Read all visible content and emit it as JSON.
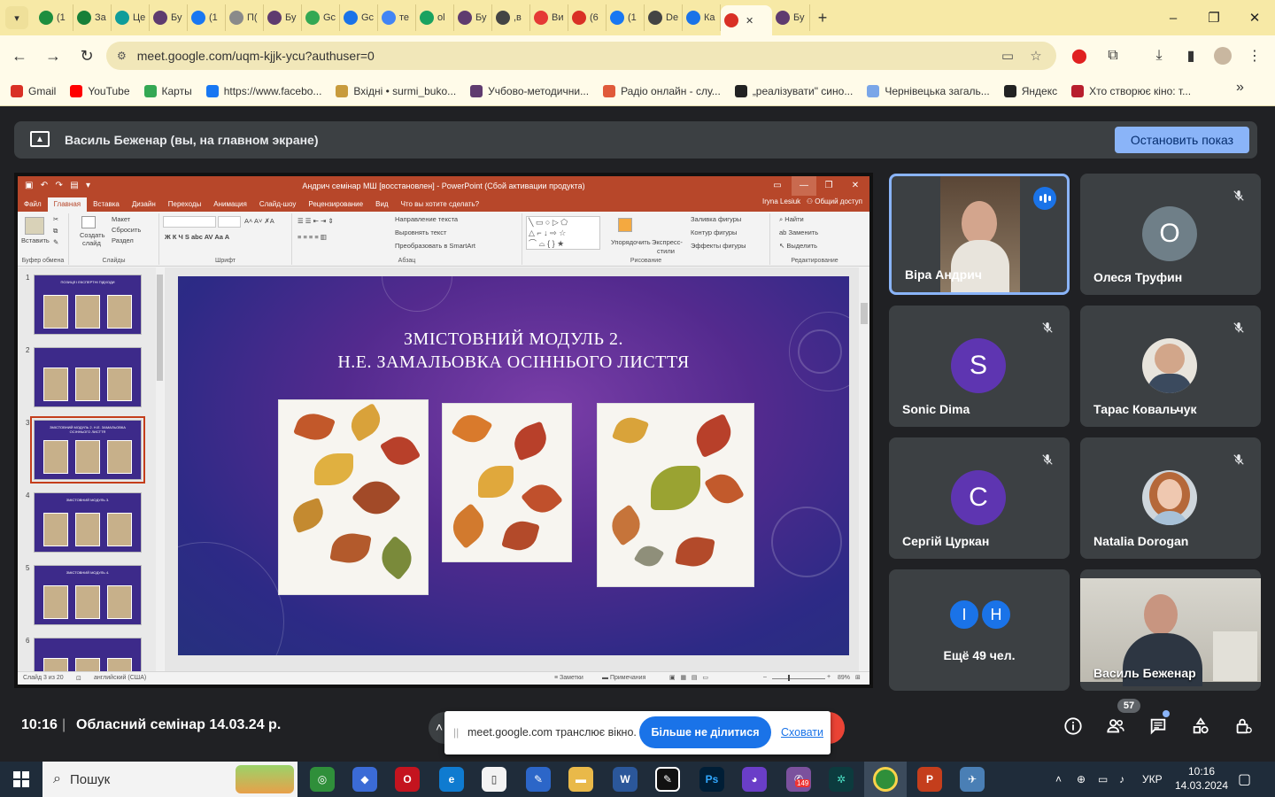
{
  "browser": {
    "tabs": [
      {
        "label": "(1",
        "icon": "spreadsheet-icon",
        "color": "#1e8e3e"
      },
      {
        "label": "За",
        "icon": "plus-square-icon",
        "color": "#188038"
      },
      {
        "label": "Це",
        "icon": "k-icon",
        "color": "#0f9d9a"
      },
      {
        "label": "Бу",
        "icon": "gear-icon",
        "color": "#5f3b6f"
      },
      {
        "label": "(1",
        "icon": "facebook-icon",
        "color": "#1877f2"
      },
      {
        "label": "П(",
        "icon": "spiral-icon",
        "color": "#8a8a8a"
      },
      {
        "label": "Бу",
        "icon": "gear-icon",
        "color": "#5f3b6f"
      },
      {
        "label": "Gc",
        "icon": "chart-icon",
        "color": "#34a853"
      },
      {
        "label": "Gc",
        "icon": "calendar-icon",
        "color": "#1a73e8"
      },
      {
        "label": "те",
        "icon": "google-icon",
        "color": "#4285f4"
      },
      {
        "label": "ol",
        "icon": "chat-icon",
        "color": "#1aa260"
      },
      {
        "label": "Бу",
        "icon": "gear-icon",
        "color": "#5f3b6f"
      },
      {
        "label": ",в",
        "icon": "globe-icon",
        "color": "#444444"
      },
      {
        "label": "Ви",
        "icon": "squares-icon",
        "color": "#e53935"
      },
      {
        "label": "(6",
        "icon": "gmail-icon",
        "color": "#d93025"
      },
      {
        "label": "(1",
        "icon": "facebook-icon",
        "color": "#1877f2"
      },
      {
        "label": "De",
        "icon": "globe-icon",
        "color": "#444444"
      },
      {
        "label": "Ка",
        "icon": "calendar-14-icon",
        "color": "#1a73e8"
      },
      {
        "label": "",
        "icon": "record-icon",
        "color": "#d93025",
        "active": true
      },
      {
        "label": "Бу",
        "icon": "gear-icon",
        "color": "#5f3b6f"
      }
    ],
    "url": "meet.google.com/uqm-kjjk-ycu?authuser=0",
    "bookmarks": [
      {
        "label": "Gmail",
        "color": "#d93025"
      },
      {
        "label": "YouTube",
        "color": "#ff0000"
      },
      {
        "label": "Карты",
        "color": "#34a853"
      },
      {
        "label": "https://www.facebo...",
        "color": "#1877f2"
      },
      {
        "label": "Вхідні • surmi_buko...",
        "color": "#c89b3c"
      },
      {
        "label": "Учбово-методични...",
        "color": "#5f3b6f"
      },
      {
        "label": "Радіо онлайн - слу...",
        "color": "#e05a3a"
      },
      {
        "label": "„реалізувати\" сино...",
        "color": "#222222"
      },
      {
        "label": "Чернівецька загаль...",
        "color": "#7aa6e8"
      },
      {
        "label": "Яндекс",
        "color": "#222222"
      },
      {
        "label": "Хто створює кіно: т...",
        "color": "#b81e2d"
      }
    ],
    "more_bookmarks": "»"
  },
  "meet": {
    "banner_text": "Василь Беженар (вы, на главном экране)",
    "stop_show_label": "Остановить показ",
    "clock": "10:16",
    "separator": "|",
    "meeting_title": "Обласний семінар 14.03.24 р.",
    "participants_count": "57",
    "share_bar": {
      "message": "meet.google.com транслює вікно.",
      "stop_label": "Більше не ділитися",
      "hide_label": "Сховати"
    },
    "participants": [
      {
        "name": "Віра Андрич",
        "speaking": true
      },
      {
        "name": "Олеся Труфин",
        "initial": "O",
        "color": "#6f7f88"
      },
      {
        "name": "Sonic Dima",
        "initial": "S",
        "color": "#5e35b1"
      },
      {
        "name": "Тарас Ковальчук"
      },
      {
        "name": "Сергій Цуркан",
        "initial": "C",
        "color": "#5e35b1"
      },
      {
        "name": "Natalia Dorogan"
      },
      {
        "name": "Ещё 49 чел.",
        "initials": [
          "I",
          "H"
        ],
        "color": "#1a73e8"
      },
      {
        "name": "Василь Беженар"
      }
    ]
  },
  "powerpoint": {
    "title": "Андрич семінар МШ [восстановлен] - PowerPoint (Сбой активации продукта)",
    "account": "Iryna Lesiuk",
    "share_label": "Общий доступ",
    "tabs": [
      "Файл",
      "Главная",
      "Вставка",
      "Дизайн",
      "Переходы",
      "Анимация",
      "Слайд-шоу",
      "Рецензирование",
      "Вид",
      "Что вы хотите сделать?"
    ],
    "ribbon": {
      "paste": "Вставить",
      "clipboard": "Буфер обмена",
      "create": "Создать",
      "slide": "слайд",
      "layout": "Макет",
      "reset": "Сбросить",
      "section": "Раздел",
      "slides_group": "Слайды",
      "font_group": "Шрифт",
      "paragraph_group": "Абзац",
      "text_direction": "Направление текста",
      "align_text": "Выровнять текст",
      "smartart": "Преобразовать в SmartArt",
      "arrange": "Упорядочить",
      "express": "Экспресс-",
      "styles": "стили",
      "fill": "Заливка фигуры",
      "outline": "Контур фигуры",
      "effects": "Эффекты фигуры",
      "drawing_group": "Рисование",
      "find": "Найти",
      "replace": "Заменить",
      "select": "Выделить",
      "editing_group": "Редактирование"
    },
    "slide": {
      "title_line1": "ЗМІСТОВНИЙ МОДУЛЬ 2.",
      "title_line2": "Н.Е. ЗАМАЛЬОВКА ОСІННЬОГО ЛИСТТЯ"
    },
    "thumbnails": [
      {
        "num": "1",
        "text": "ПОЗИЦІЇ І ЕКСПЕРТНІ ПІДХОДИ"
      },
      {
        "num": "2",
        "text": ""
      },
      {
        "num": "3",
        "text": "ЗМІСТОВНИЙ МОДУЛЬ 2. Н.Е. ЗАМАЛЬОВКА ОСІННЬОГО ЛИСТТЯ",
        "selected": true
      },
      {
        "num": "4",
        "text": "ЗМІСТОВНИЙ МОДУЛЬ 3."
      },
      {
        "num": "5",
        "text": "ЗМІСТОВНИЙ МОДУЛЬ 4."
      },
      {
        "num": "6",
        "text": ""
      }
    ],
    "status": {
      "slide_of": "Слайд 3 из 20",
      "language": "английский (США)",
      "notes": "Заметки",
      "comments": "Примечания",
      "zoom": "89%"
    }
  },
  "taskbar": {
    "search_label": "Пошук",
    "lang": "УКР",
    "time": "10:16",
    "date": "14.03.2024",
    "viber_badge": "149"
  }
}
